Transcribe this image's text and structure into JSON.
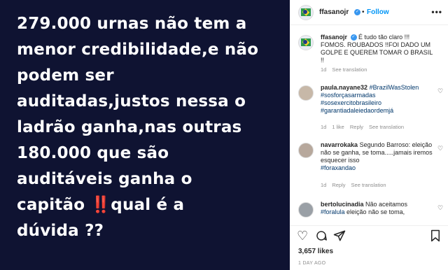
{
  "media": {
    "lines": [
      "279.000 urnas não tem a",
      "menor credibilidade,e não",
      "podem ser",
      "auditadas,justos nessa o",
      "ladrão ganha,nas outras",
      "180.000 que são",
      "auditáveis ganha o",
      "capitão ",
      "qual é a",
      "dúvida ??"
    ],
    "emoji": "‼️"
  },
  "header": {
    "username": "ffasanojr",
    "follow_label": "Follow",
    "more_label": "•••",
    "separator": "•"
  },
  "caption": {
    "username": "ffasanojr",
    "text": "É tudo tão claro !!! FOMOS. ROUBADOS !!FOI DADO UM GOLPE E QUEREM TOMAR O BRASIL !!",
    "time": "1d",
    "see_translation": "See translation"
  },
  "comments": [
    {
      "username": "paula.nayane32",
      "text_tags": [
        "#BrazilWasStolen",
        "#sosforçasarmadas",
        "#sosexercitobrasileiro",
        "#garantiadaleiedaordemjá"
      ],
      "time": "1d",
      "likes": "1 like",
      "reply": "Reply",
      "see_translation": "See translation"
    },
    {
      "username": "navarrokaka",
      "text": "Segundo Barroso: eleição não se ganha, se toma.....jamais iremos esquecer isso",
      "tag": "#foraxandao",
      "time": "1d",
      "reply": "Reply",
      "see_translation": "See translation"
    },
    {
      "username": "bertolucinadia",
      "text_pre": "Não aceitamos",
      "tag": "#foralula",
      "text_post": "eleição não se toma,"
    }
  ],
  "actions": {
    "likes": "3,657 likes",
    "time_ago": "1 DAY AGO"
  },
  "colors": {
    "media_bg": "#0f1332",
    "link_blue": "#0095f6",
    "hashtag": "#00376b"
  }
}
